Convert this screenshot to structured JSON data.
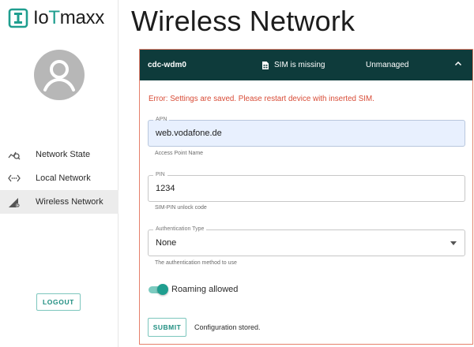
{
  "brand": {
    "name_prefix": "Io",
    "name_accent": "T",
    "name_suffix": "maxx",
    "icon": "iotmaxx-logo-icon",
    "accent_color": "#1f9e8f"
  },
  "sidebar": {
    "avatar": "account-circle-icon",
    "items": [
      {
        "label": "Network State",
        "icon": "network-state-icon",
        "active": false
      },
      {
        "label": "Local Network",
        "icon": "local-network-icon",
        "active": false
      },
      {
        "label": "Wireless Network",
        "icon": "wireless-network-icon",
        "active": true
      }
    ],
    "logout_label": "LOGOUT"
  },
  "page": {
    "title": "Wireless Network"
  },
  "card": {
    "header": {
      "interface": "cdc-wdm0",
      "sim_status": "SIM is missing",
      "sim_icon": "sim-card-icon",
      "mode": "Unmanaged",
      "collapse_icon": "chevron-up-icon",
      "background": "#0e3b3b"
    },
    "border_color": "#e67f6b",
    "error": "Error: Settings are saved. Please restart device with inserted SIM.",
    "error_color": "#d84b36",
    "fields": {
      "apn": {
        "label": "APN",
        "value": "web.vodafone.de",
        "helper": "Access Point Name"
      },
      "pin": {
        "label": "PIN",
        "value": "1234",
        "helper": "SIM-PIN unlock code"
      },
      "auth": {
        "label": "Authentication Type",
        "value": "None",
        "helper": "The authentication method to use"
      }
    },
    "roaming": {
      "label": "Roaming allowed",
      "enabled": true
    },
    "submit_label": "SUBMIT",
    "status_message": "Configuration stored."
  }
}
